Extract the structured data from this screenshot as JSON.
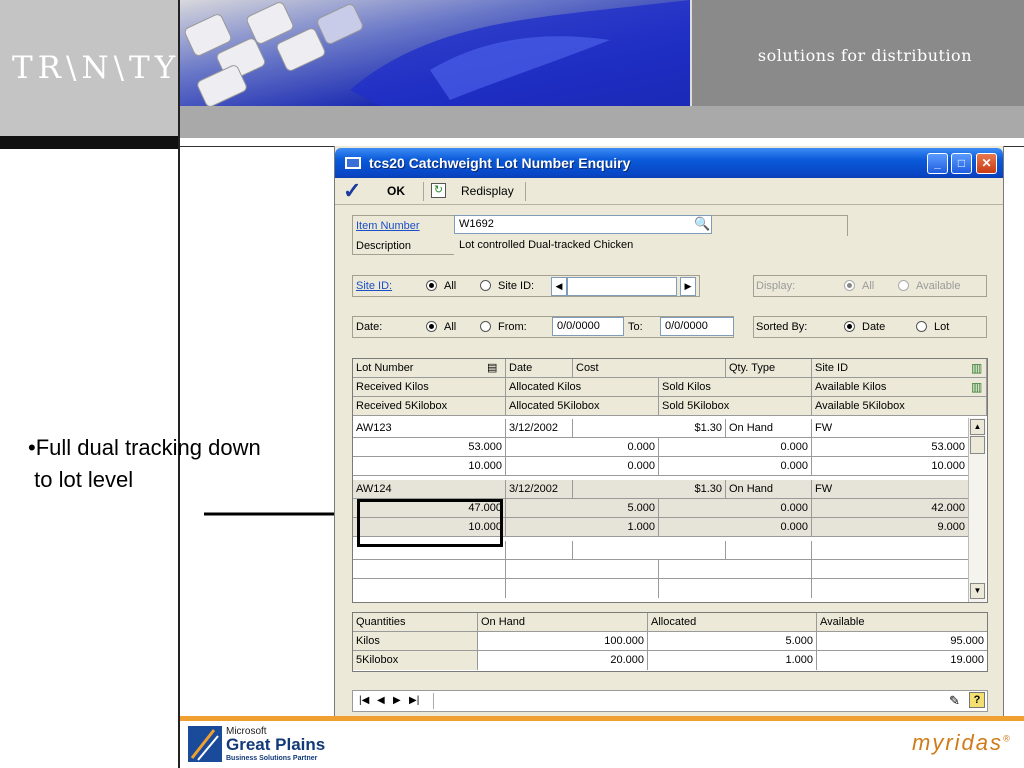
{
  "header": {
    "logo_text": "TR\\N\\TY",
    "tagline": "solutions for distribution"
  },
  "bullet": {
    "text": "•Full dual tracking down\n to lot level"
  },
  "footer": {
    "microsoft": "Microsoft",
    "great_plains": "Great Plains",
    "partner": "Business Solutions Partner",
    "myridas": "myridas"
  },
  "window": {
    "title": "tcs20 Catchweight Lot Number Enquiry",
    "toolbar": {
      "ok": "OK",
      "redisplay": "Redisplay"
    },
    "item_number_label": "Item Number",
    "item_number_value": "W1692",
    "description_label": "Description",
    "description_value": "Lot controlled Dual-tracked Chicken",
    "site_label": "Site ID:",
    "site_all": "All",
    "site_id_option": "Site ID:",
    "display_label": "Display:",
    "display_all": "All",
    "display_available": "Available",
    "date_label": "Date:",
    "date_all": "All",
    "date_from": "From:",
    "date_from_value": "0/0/0000",
    "date_to": "To:",
    "date_to_value": "0/0/0000",
    "sorted_by_label": "Sorted By:",
    "sort_date": "Date",
    "sort_lot": "Lot",
    "grid_headers": {
      "row1": [
        "Lot Number",
        "Date",
        "Cost",
        "Qty. Type",
        "Site ID"
      ],
      "row2": [
        "Received Kilos",
        "Allocated Kilos",
        "Sold Kilos",
        "Available Kilos"
      ],
      "row3": [
        "Received 5Kilobox",
        "Allocated 5Kilobox",
        "Sold 5Kilobox",
        "Available 5Kilobox"
      ]
    },
    "lots": [
      {
        "lot": "AW123",
        "date": "3/12/2002",
        "cost": "$1.30",
        "qty_type": "On Hand",
        "site": "FW",
        "kilos": [
          "53.000",
          "0.000",
          "0.000",
          "53.000"
        ],
        "boxes": [
          "10.000",
          "0.000",
          "0.000",
          "10.000"
        ]
      },
      {
        "lot": "AW124",
        "date": "3/12/2002",
        "cost": "$1.30",
        "qty_type": "On Hand",
        "site": "FW",
        "kilos": [
          "47.000",
          "5.000",
          "0.000",
          "42.000"
        ],
        "boxes": [
          "10.000",
          "1.000",
          "0.000",
          "9.000"
        ]
      }
    ],
    "summary": {
      "headers": [
        "Quantities",
        "On Hand",
        "Allocated",
        "Available"
      ],
      "rows": [
        [
          "Kilos",
          "100.000",
          "5.000",
          "95.000"
        ],
        [
          "5Kilobox",
          "20.000",
          "1.000",
          "19.000"
        ]
      ]
    }
  }
}
